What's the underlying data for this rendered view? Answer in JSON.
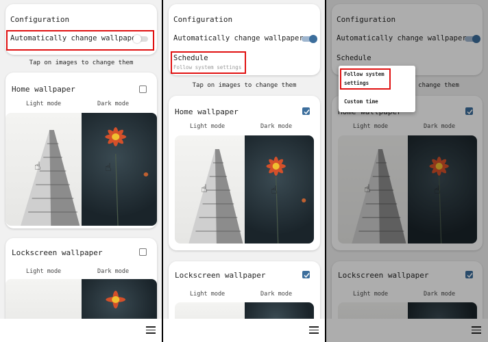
{
  "configuration": {
    "title": "Configuration",
    "auto_change_label": "Automatically change wallpaper",
    "schedule_label": "Schedule",
    "schedule_value": "Follow system settings"
  },
  "hint": "Tap on images to change them",
  "home_wallpaper": {
    "title": "Home wallpaper",
    "light_label": "Light mode",
    "dark_label": "Dark mode"
  },
  "lockscreen_wallpaper": {
    "title": "Lockscreen wallpaper",
    "light_label": "Light mode",
    "dark_label": "Dark mode"
  },
  "schedule_menu": {
    "options": [
      "Follow system settings",
      "Custom time"
    ]
  },
  "panels": [
    {
      "auto_change_enabled": false,
      "home_checked": false,
      "lock_checked": false
    },
    {
      "auto_change_enabled": true,
      "home_checked": true,
      "lock_checked": true
    },
    {
      "auto_change_enabled": true,
      "home_checked": true,
      "lock_checked": true
    }
  ],
  "colors": {
    "accent": "#3c6e9c",
    "highlight": "#e01010"
  },
  "icons": {
    "menu": "hamburger-menu-icon",
    "check": "check-icon",
    "tap": "tap-hand-icon"
  }
}
